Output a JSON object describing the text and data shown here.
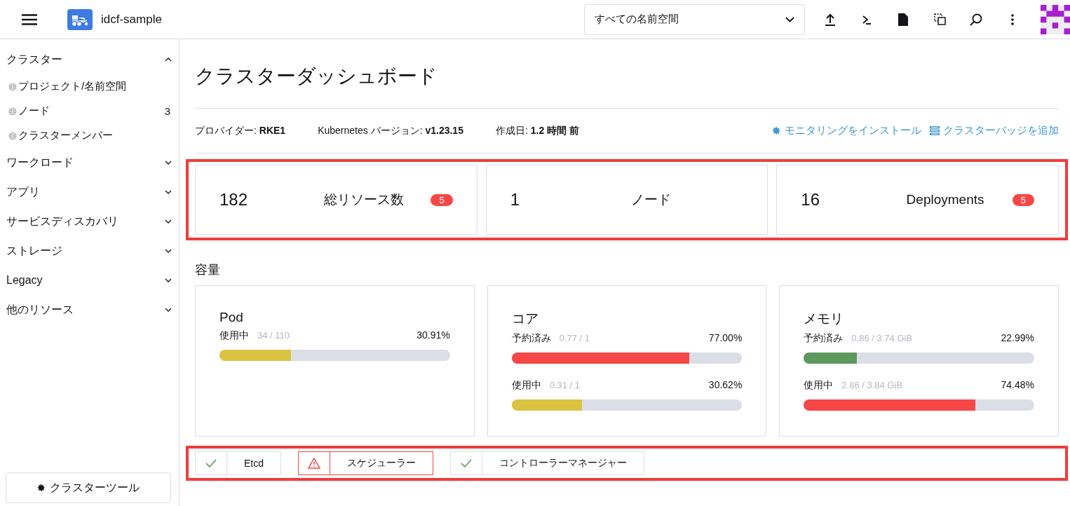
{
  "header": {
    "cluster_name": "idcf-sample",
    "namespace_select": "すべての名前空間"
  },
  "sidebar": {
    "groups": [
      {
        "label": "クラスター",
        "expanded": true,
        "children": [
          {
            "label": "プロジェクト/名前空間"
          },
          {
            "label": "ノード",
            "count": "3"
          },
          {
            "label": "クラスターメンバー"
          }
        ]
      },
      {
        "label": "ワークロード",
        "expanded": false
      },
      {
        "label": "アプリ",
        "expanded": false
      },
      {
        "label": "サービスディスカバリ",
        "expanded": false
      },
      {
        "label": "ストレージ",
        "expanded": false
      },
      {
        "label": "Legacy",
        "expanded": false
      },
      {
        "label": "他のリソース",
        "expanded": false
      }
    ],
    "tools_button": "クラスターツール"
  },
  "page": {
    "title": "クラスターダッシュボード",
    "info": [
      {
        "label": "プロバイダー:",
        "value": "RKE1"
      },
      {
        "label": "Kubernetes バージョン:",
        "value": "v1.23.15"
      },
      {
        "label": "作成日:",
        "value": "1.2 時間 前"
      }
    ],
    "actions": [
      {
        "kind": "gear",
        "label": "モニタリングをインストール"
      },
      {
        "kind": "badge",
        "label": "クラスターバッジを追加"
      }
    ]
  },
  "summary": {
    "highlighted": true,
    "cards": [
      {
        "count": "182",
        "label": "総リソース数",
        "badge": "5"
      },
      {
        "count": "1",
        "label": "ノード"
      },
      {
        "count": "16",
        "label": "Deployments",
        "badge": "5"
      }
    ]
  },
  "capacity": {
    "title": "容量",
    "cards": [
      {
        "title": "Pod",
        "meters": [
          {
            "label": "使用中",
            "detail": "34 / 110",
            "reading": "30.91%",
            "level": 0.3091,
            "color": "#dbc342"
          }
        ]
      },
      {
        "title": "コア",
        "meters": [
          {
            "label": "予約済み",
            "detail": "0.77 / 1",
            "reading": "77.00%",
            "level": 0.77,
            "color": "#f64747"
          },
          {
            "label": "使用中",
            "detail": "0.31 / 1",
            "reading": "30.62%",
            "level": 0.3062,
            "color": "#dbc342"
          }
        ]
      },
      {
        "title": "メモリ",
        "meters": [
          {
            "label": "予約済み",
            "detail": "0.86 / 3.74 GiB",
            "reading": "22.99%",
            "level": 0.2299,
            "color": "#5d995d"
          },
          {
            "label": "使用中",
            "detail": "2.86 / 3.84 GiB",
            "reading": "74.48%",
            "level": 0.7448,
            "color": "#f64747"
          }
        ]
      }
    ]
  },
  "components": {
    "highlighted": true,
    "items": [
      {
        "label": "Etcd",
        "kind": "ok"
      },
      {
        "label": "スケジューラー",
        "kind": "warning"
      },
      {
        "label": "コントローラーマネージャー",
        "kind": "ok"
      }
    ]
  }
}
